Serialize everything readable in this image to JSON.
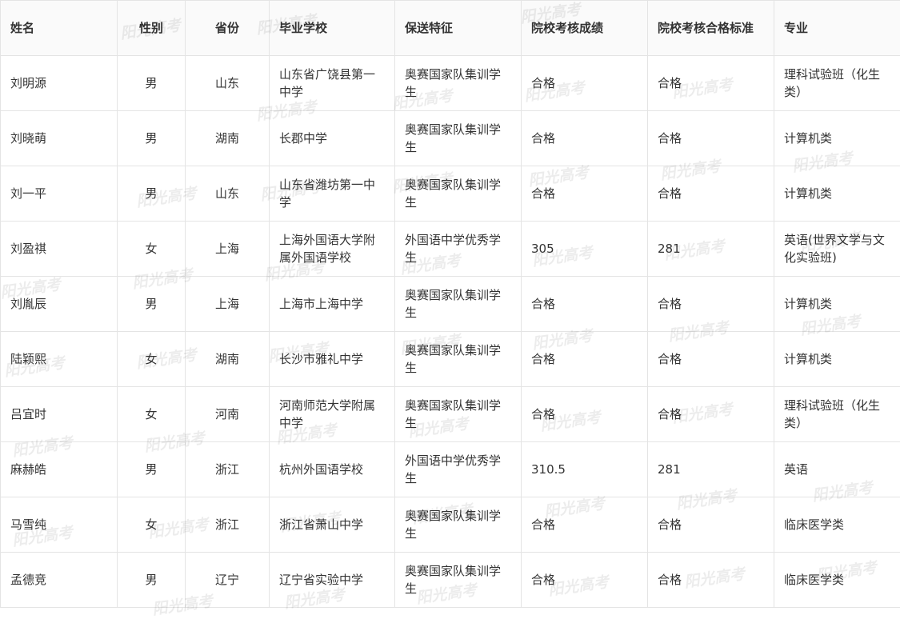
{
  "watermark_text": "阳光高考",
  "headers": [
    "姓名",
    "性别",
    "省份",
    "毕业学校",
    "保送特征",
    "院校考核成绩",
    "院校考核合格标准",
    "专业"
  ],
  "rows": [
    [
      "刘明源",
      "男",
      "山东",
      "山东省广饶县第一中学",
      "奥赛国家队集训学生",
      "合格",
      "合格",
      "理科试验班（化生类）"
    ],
    [
      "刘晓萌",
      "男",
      "湖南",
      "长郡中学",
      "奥赛国家队集训学生",
      "合格",
      "合格",
      "计算机类"
    ],
    [
      "刘一平",
      "男",
      "山东",
      "山东省潍坊第一中学",
      "奥赛国家队集训学生",
      "合格",
      "合格",
      "计算机类"
    ],
    [
      "刘盈祺",
      "女",
      "上海",
      "上海外国语大学附属外国语学校",
      "外国语中学优秀学生",
      "305",
      "281",
      "英语(世界文学与文化实验班)"
    ],
    [
      "刘胤辰",
      "男",
      "上海",
      "上海市上海中学",
      "奥赛国家队集训学生",
      "合格",
      "合格",
      "计算机类"
    ],
    [
      "陆颖熙",
      "女",
      "湖南",
      "长沙市雅礼中学",
      "奥赛国家队集训学生",
      "合格",
      "合格",
      "计算机类"
    ],
    [
      "吕宜时",
      "女",
      "河南",
      "河南师范大学附属中学",
      "奥赛国家队集训学生",
      "合格",
      "合格",
      "理科试验班（化生类）"
    ],
    [
      "麻赫皓",
      "男",
      "浙江",
      "杭州外国语学校",
      "外国语中学优秀学生",
      "310.5",
      "281",
      "英语"
    ],
    [
      "马雪纯",
      "女",
      "浙江",
      "浙江省萧山中学",
      "奥赛国家队集训学生",
      "合格",
      "合格",
      "临床医学类"
    ],
    [
      "孟德竞",
      "男",
      "辽宁",
      "辽宁省实验中学",
      "奥赛国家队集训学生",
      "合格",
      "合格",
      "临床医学类"
    ]
  ]
}
